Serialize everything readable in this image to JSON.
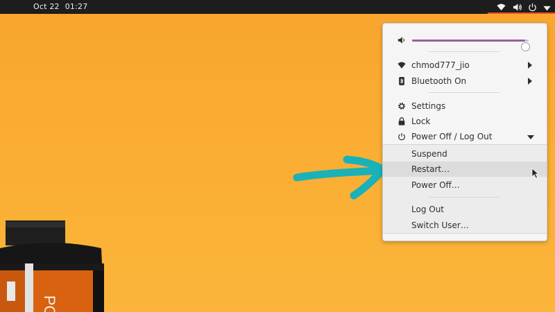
{
  "topbar": {
    "date": "Oct 22",
    "time": "01:27",
    "tray_icons": [
      "wifi-icon",
      "volume-icon",
      "power-icon",
      "chevron-down-icon"
    ]
  },
  "menu": {
    "volume": {
      "level": 0.97,
      "icon": "volume-icon"
    },
    "wifi": {
      "label": "chmod777_jio",
      "icon": "wifi-icon"
    },
    "bluetooth": {
      "label": "Bluetooth On",
      "icon": "bluetooth-icon"
    },
    "settings": {
      "label": "Settings",
      "icon": "gear-icon"
    },
    "lock": {
      "label": "Lock",
      "icon": "lock-icon"
    },
    "power": {
      "label": "Power Off / Log Out",
      "icon": "power-icon"
    },
    "submenu": {
      "suspend": "Suspend",
      "restart": "Restart…",
      "power_off": "Power Off…",
      "log_out": "Log Out",
      "switch_user": "Switch User…"
    }
  },
  "colors": {
    "topbar": "#1d1d1d",
    "accent": "#e95420",
    "slider": "#9c5a9c",
    "arrow": "#1ab1b8",
    "desktop": "#f9aa30"
  },
  "desktop_text": "PO"
}
